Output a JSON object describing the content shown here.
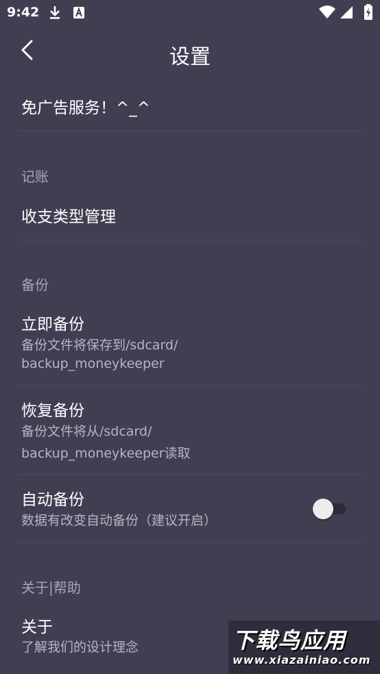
{
  "status": {
    "time": "9:42",
    "left_icons": [
      "download-icon",
      "a-box-icon"
    ],
    "right_icons": [
      "wifi-icon",
      "signal-icon",
      "battery-icon"
    ]
  },
  "app_bar": {
    "title": "设置",
    "back_icon": "chevron-left-icon"
  },
  "items": {
    "ad_free": {
      "title": "免广告服务！^_^"
    },
    "section_bookkeeping": "记账",
    "category_manage": {
      "title": "收支类型管理"
    },
    "section_backup": "备份",
    "backup_now": {
      "title": "立即备份",
      "subtitle_line1": "备份文件将保存到/sdcard/",
      "subtitle_line2": "backup_moneykeeper"
    },
    "restore_backup": {
      "title": "恢复备份",
      "subtitle_line1": "备份文件将从/sdcard/",
      "subtitle_line2": "backup_moneykeeper读取"
    },
    "auto_backup": {
      "title": "自动备份",
      "subtitle": "数据有改变自动备份（建议开启）",
      "enabled": false
    },
    "section_about": "关于|帮助",
    "about": {
      "title": "关于",
      "subtitle": "了解我们的设计理念"
    }
  },
  "watermark": {
    "main": "下载鸟应用",
    "sub": "www.xiazainiao.com"
  },
  "colors": {
    "background": "#403f52",
    "text_primary": "#ffffff",
    "text_secondary": "#b5b4c4",
    "divider": "#4c4b5e"
  }
}
